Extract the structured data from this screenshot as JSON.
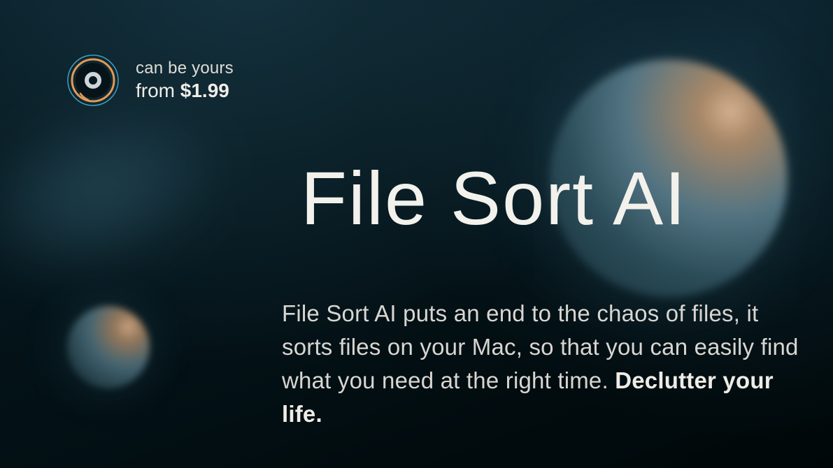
{
  "badge": {
    "price_prefix": "can be yours",
    "price_from_word": "from",
    "price_value": "$1.99"
  },
  "hero": {
    "title": "File Sort AI",
    "body_main": "File Sort AI puts an end to the chaos of files, it sorts files on your Mac, so that you can easily find what you need at the right time. ",
    "body_bold": "Declutter your life."
  }
}
